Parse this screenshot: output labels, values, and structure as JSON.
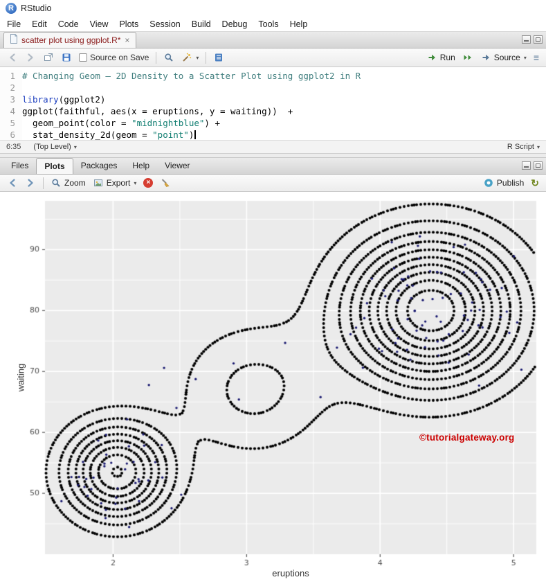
{
  "window": {
    "title": "RStudio"
  },
  "icons": {
    "caret": "▾",
    "close": "×",
    "refresh": "↻",
    "outline": "≡",
    "delete_x": "×"
  },
  "menubar": {
    "items": [
      "File",
      "Edit",
      "Code",
      "View",
      "Plots",
      "Session",
      "Build",
      "Debug",
      "Tools",
      "Help"
    ]
  },
  "source_pane": {
    "tab_label": "scatter plot using ggplot.R*",
    "toolbar": {
      "source_on_save": "Source on Save",
      "run": "Run",
      "source": "Source"
    },
    "editor": {
      "lines": [
        {
          "num": "1",
          "segments": [
            {
              "style": "comment",
              "text": "# Changing Geom – 2D Density to a Scatter Plot using ggplot2 in R"
            }
          ]
        },
        {
          "num": "2",
          "segments": []
        },
        {
          "num": "3",
          "segments": [
            {
              "style": "keyword",
              "text": "library"
            },
            {
              "style": "plain",
              "text": "(ggplot2)"
            }
          ]
        },
        {
          "num": "4",
          "segments": [
            {
              "style": "plain",
              "text": "ggplot(faithful, aes(x = eruptions, y = waiting))  +"
            }
          ]
        },
        {
          "num": "5",
          "segments": [
            {
              "style": "plain",
              "text": "  geom_point(color = "
            },
            {
              "style": "string",
              "text": "\"midnightblue\""
            },
            {
              "style": "plain",
              "text": ") +"
            }
          ]
        },
        {
          "num": "6",
          "segments": [
            {
              "style": "plain",
              "text": "  stat_density_2d(geom = "
            },
            {
              "style": "string",
              "text": "\"point\""
            },
            {
              "style": "plain",
              "text": ")"
            }
          ],
          "cursor": true
        }
      ]
    },
    "status": {
      "cursor_position": "6:35",
      "scope": "(Top Level)",
      "file_type": "R Script"
    }
  },
  "bottom_pane": {
    "tabs": [
      "Files",
      "Plots",
      "Packages",
      "Help",
      "Viewer"
    ],
    "active_tab": "Plots",
    "toolbar": {
      "zoom": "Zoom",
      "export": "Export",
      "publish": "Publish"
    }
  },
  "chart_data": {
    "type": "scatter",
    "title": "",
    "xlabel": "eruptions",
    "ylabel": "waiting",
    "xlim": [
      1.49,
      5.17
    ],
    "ylim": [
      40,
      98
    ],
    "x_ticks": [
      2,
      3,
      4,
      5
    ],
    "y_ticks": [
      50,
      60,
      70,
      80,
      90
    ],
    "x_minor_ticks": [
      2.5,
      3.5,
      4.5
    ],
    "y_minor_ticks": [
      45,
      55,
      65,
      75,
      85,
      95
    ],
    "panel_bg": "#ebebeb",
    "grid_color": "#ffffff",
    "contour_dot_color": "#000000",
    "data_point_color": "#191970",
    "watermark": "©tutorialgateway.org",
    "watermark_color": "#cc0000",
    "description": "2D density contours of the faithful dataset (eruptions vs waiting) drawn as rings of black points via stat_density_2d(geom = \"point\"), over midnightblue data points from geom_point; lower-left cluster near (2, 53), upper-right cluster near (4.4, 80), outer contours joined through a channel near (3.1, 67)",
    "density_components": [
      {
        "weight": 0.46,
        "cx": 2.03,
        "cy": 53.5,
        "sx": 0.26,
        "sy": 5.2
      },
      {
        "weight": 0.62,
        "cx": 4.38,
        "cy": 80.0,
        "sx": 0.42,
        "sy": 8.0
      },
      {
        "weight": 0.13,
        "cx": 3.05,
        "cy": 67.0,
        "sx": 0.38,
        "sy": 7.5
      }
    ],
    "n_levels": 10,
    "max_density": 0.625,
    "scatter_clusters": [
      {
        "n": 42,
        "cx": 2.0,
        "cy": 53.5,
        "sx": 0.21,
        "sy": 4.2
      },
      {
        "n": 78,
        "cx": 4.38,
        "cy": 80.0,
        "sx": 0.34,
        "sy": 5.6
      }
    ],
    "scatter_outliers": {
      "n": 8,
      "x_range": [
        2.2,
        3.7
      ],
      "y_range": [
        57,
        76
      ]
    },
    "seed": 42
  }
}
